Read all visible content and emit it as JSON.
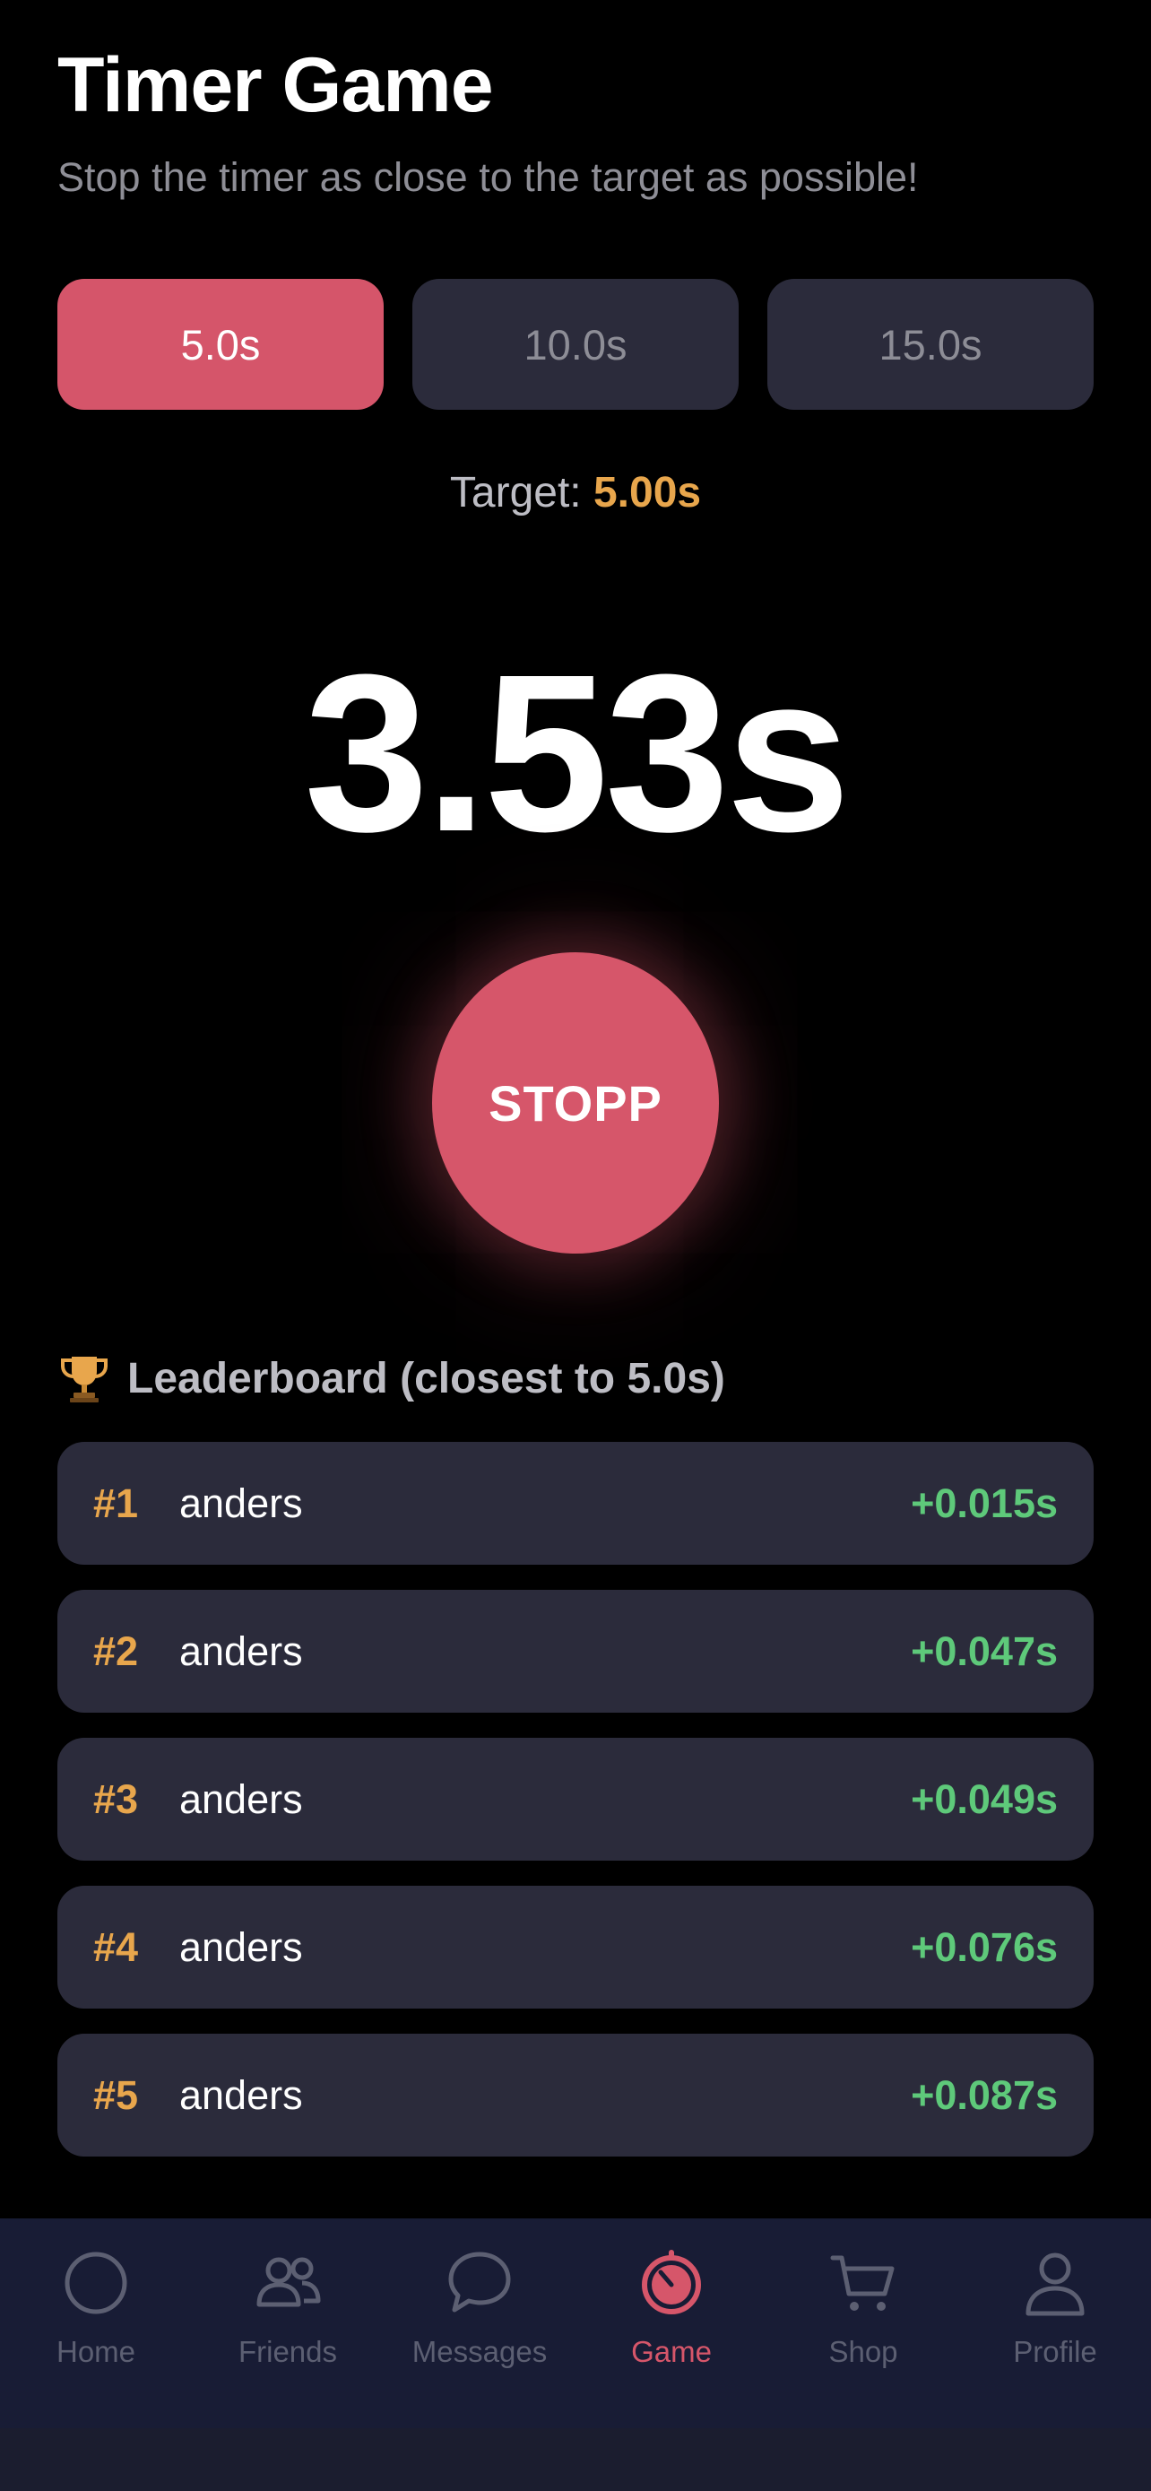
{
  "header": {
    "title": "Timer Game",
    "subtitle": "Stop the timer as close to the target as possible!"
  },
  "options": [
    {
      "label": "5.0s",
      "selected": true
    },
    {
      "label": "10.0s",
      "selected": false
    },
    {
      "label": "15.0s",
      "selected": false
    }
  ],
  "target": {
    "label": "Target: ",
    "value": "5.00s"
  },
  "timer": {
    "display": "3.53s"
  },
  "stop_button": {
    "label": "STOPP"
  },
  "leaderboard": {
    "title": "Leaderboard (closest to 5.0s)",
    "icon": "trophy-icon",
    "rows": [
      {
        "rank": "#1",
        "name": "anders",
        "diff": "+0.015s"
      },
      {
        "rank": "#2",
        "name": "anders",
        "diff": "+0.047s"
      },
      {
        "rank": "#3",
        "name": "anders",
        "diff": "+0.049s"
      },
      {
        "rank": "#4",
        "name": "anders",
        "diff": "+0.076s"
      },
      {
        "rank": "#5",
        "name": "anders",
        "diff": "+0.087s"
      }
    ]
  },
  "tabbar": {
    "items": [
      {
        "label": "Home",
        "icon": "home-icon",
        "active": false
      },
      {
        "label": "Friends",
        "icon": "friends-icon",
        "active": false
      },
      {
        "label": "Messages",
        "icon": "messages-icon",
        "active": false
      },
      {
        "label": "Game",
        "icon": "game-timer-icon",
        "active": true
      },
      {
        "label": "Shop",
        "icon": "cart-icon",
        "active": false
      },
      {
        "label": "Profile",
        "icon": "profile-icon",
        "active": false
      }
    ]
  },
  "colors": {
    "accent": "#d6566a",
    "gold": "#e8a64c",
    "positive": "#5ec97a",
    "card": "#2b2b3b",
    "tabbar": "#181c35"
  }
}
